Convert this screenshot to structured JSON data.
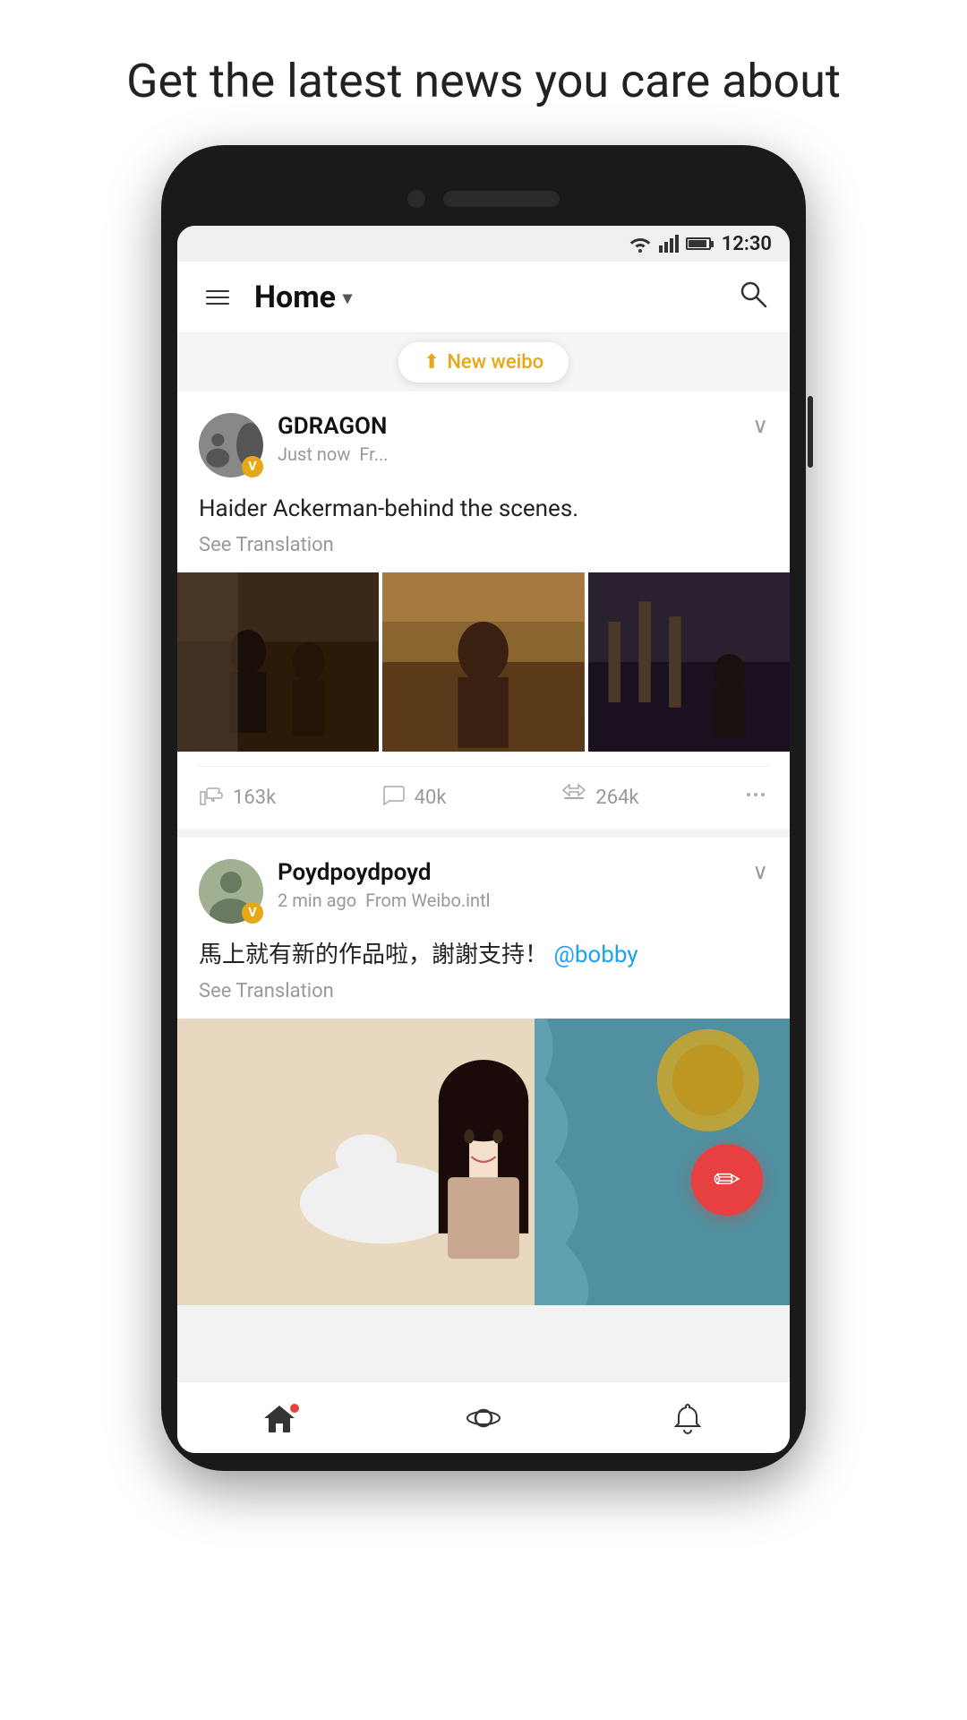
{
  "headline": "Get the latest news you care about",
  "statusBar": {
    "time": "12:30"
  },
  "navBar": {
    "title": "Home",
    "dropdownLabel": "▾"
  },
  "newWeibo": {
    "label": "New weibo",
    "icon": "↑"
  },
  "posts": [
    {
      "id": "post-1",
      "username": "GDRAGON",
      "timeAgo": "Just now",
      "fromSource": "Fr...",
      "postText": "Haider Ackerman-behind the scenes.",
      "seeTranslation": "See Translation",
      "likes": "163k",
      "comments": "40k",
      "reposts": "264k",
      "hasImages": true
    },
    {
      "id": "post-2",
      "username": "Poydpoydpoyd",
      "timeAgo": "2 min ago",
      "fromSource": "From Weibo.intl",
      "postText": "馬上就有新的作品啦，謝謝支持！",
      "mention": "@bobby",
      "seeTranslation": "See Translation",
      "hasLargeImage": true
    }
  ],
  "bottomNav": {
    "home": "home",
    "explore": "explore",
    "notifications": "notifications"
  },
  "fab": {
    "icon": "✏"
  }
}
